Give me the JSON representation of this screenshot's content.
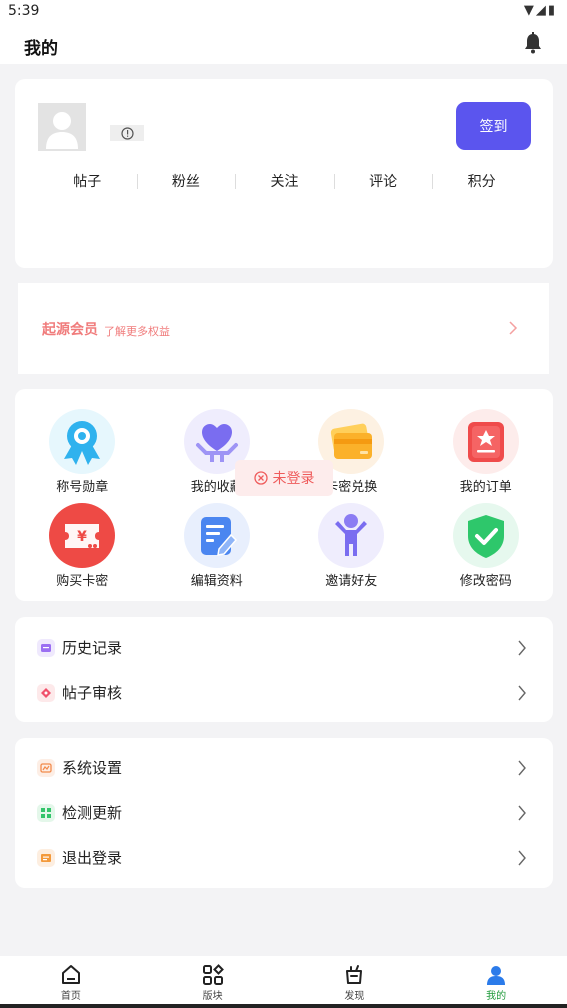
{
  "status_bar": {
    "time": "5:39"
  },
  "header": {
    "title": "我的"
  },
  "profile": {
    "checkin_label": "签到",
    "stats": [
      "帖子",
      "粉丝",
      "关注",
      "评论",
      "积分"
    ]
  },
  "vip": {
    "title": "起源会员",
    "subtitle": "了解更多权益"
  },
  "grid": [
    {
      "label": "称号勋章",
      "icon": "badge-icon"
    },
    {
      "label": "我的收藏",
      "icon": "heart-hand-icon"
    },
    {
      "label": "卡密兑换",
      "icon": "card-icon"
    },
    {
      "label": "我的订单",
      "icon": "order-icon"
    },
    {
      "label": "购买卡密",
      "icon": "ticket-icon"
    },
    {
      "label": "编辑资料",
      "icon": "edit-icon"
    },
    {
      "label": "邀请好友",
      "icon": "person-icon"
    },
    {
      "label": "修改密码",
      "icon": "shield-icon"
    }
  ],
  "toast": {
    "text": "未登录"
  },
  "list1": [
    {
      "label": "历史记录",
      "icon": "history-icon"
    },
    {
      "label": "帖子审核",
      "icon": "review-icon"
    }
  ],
  "list2": [
    {
      "label": "系统设置",
      "icon": "settings-icon"
    },
    {
      "label": "检测更新",
      "icon": "update-icon"
    },
    {
      "label": "退出登录",
      "icon": "logout-icon"
    }
  ],
  "tabbar": {
    "items": [
      {
        "label": "首页",
        "icon": "home-icon"
      },
      {
        "label": "版块",
        "icon": "sections-icon"
      },
      {
        "label": "发现",
        "icon": "discover-icon"
      },
      {
        "label": "我的",
        "icon": "profile-icon"
      }
    ],
    "active_index": 3
  },
  "colors": {
    "accent": "#5b55ee",
    "vip": "#f07c7c",
    "active_tab": "#1f9a3a",
    "toast": "#ef5b5b"
  }
}
